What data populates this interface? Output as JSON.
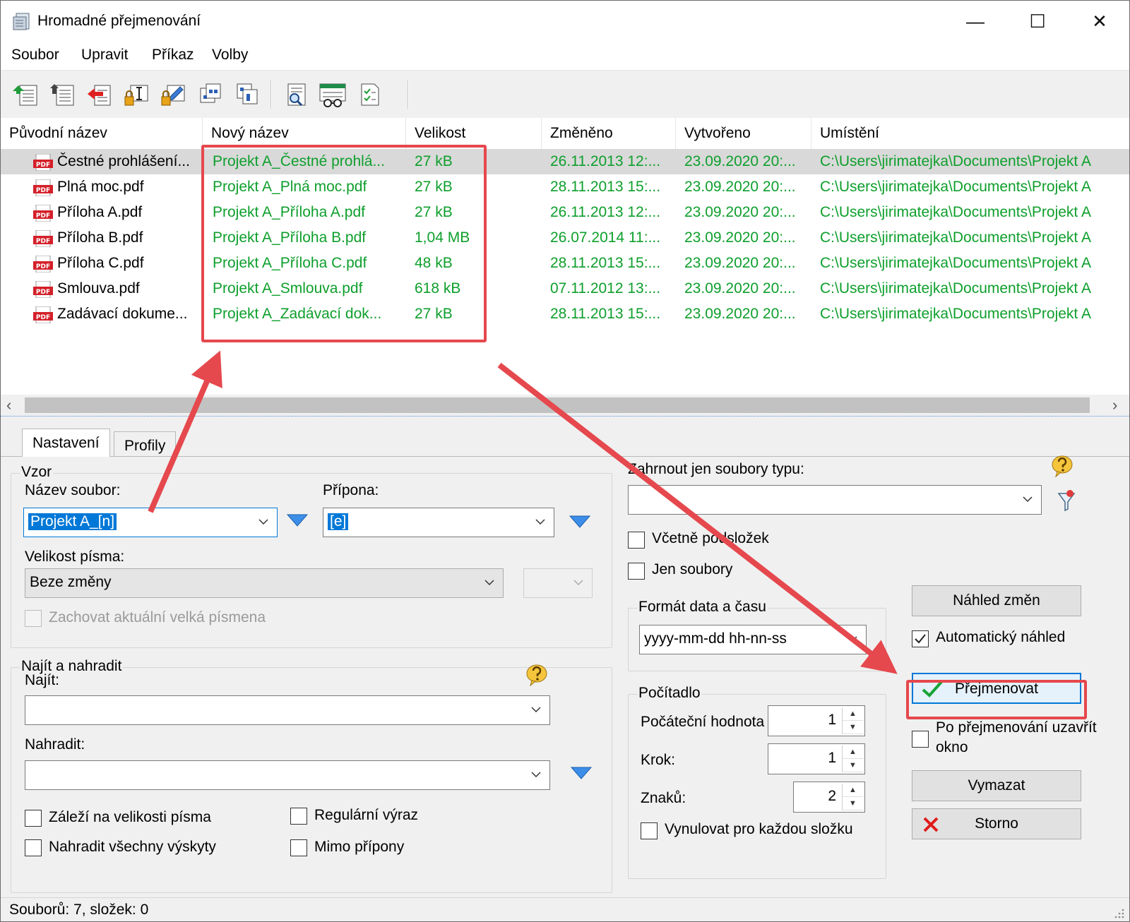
{
  "window": {
    "title": "Hromadné přejmenování",
    "minimize": "—",
    "maximize": "☐",
    "close": "✕"
  },
  "menu": [
    "Soubor",
    "Upravit",
    "Příkaz",
    "Volby"
  ],
  "toolbar": [
    "add-files-icon",
    "add-folder-icon",
    "remove-icon",
    "rename-lock-icon",
    "edit-lock-icon",
    "move-up-icon",
    "move-down-icon",
    "preview-icon",
    "settings-icon",
    "checklist-icon"
  ],
  "columns": [
    "Původní název",
    "Nový název",
    "Velikost",
    "Změněno",
    "Vytvořeno",
    "Umístění"
  ],
  "files": [
    {
      "orig": "Čestné prohlášení...",
      "new": "Projekt A_Čestné prohlá...",
      "size": "27 kB",
      "modified": "26.11.2013 12:...",
      "created": "23.09.2020 20:...",
      "path": "C:\\Users\\jirimatejka\\Documents\\Projekt A"
    },
    {
      "orig": "Plná moc.pdf",
      "new": "Projekt A_Plná moc.pdf",
      "size": "27 kB",
      "modified": "28.11.2013 15:...",
      "created": "23.09.2020 20:...",
      "path": "C:\\Users\\jirimatejka\\Documents\\Projekt A"
    },
    {
      "orig": "Příloha A.pdf",
      "new": "Projekt A_Příloha A.pdf",
      "size": "27 kB",
      "modified": "26.11.2013 12:...",
      "created": "23.09.2020 20:...",
      "path": "C:\\Users\\jirimatejka\\Documents\\Projekt A"
    },
    {
      "orig": "Příloha B.pdf",
      "new": "Projekt A_Příloha B.pdf",
      "size": "1,04 MB",
      "modified": "26.07.2014 11:...",
      "created": "23.09.2020 20:...",
      "path": "C:\\Users\\jirimatejka\\Documents\\Projekt A"
    },
    {
      "orig": "Příloha C.pdf",
      "new": "Projekt A_Příloha C.pdf",
      "size": "48 kB",
      "modified": "28.11.2013 15:...",
      "created": "23.09.2020 20:...",
      "path": "C:\\Users\\jirimatejka\\Documents\\Projekt A"
    },
    {
      "orig": "Smlouva.pdf",
      "new": "Projekt A_Smlouva.pdf",
      "size": "618 kB",
      "modified": "07.11.2012 13:...",
      "created": "23.09.2020 20:...",
      "path": "C:\\Users\\jirimatejka\\Documents\\Projekt A"
    },
    {
      "orig": "Zadávací dokume...",
      "new": "Projekt A_Zadávací dok...",
      "size": "27 kB",
      "modified": "28.11.2013 15:...",
      "created": "23.09.2020 20:...",
      "path": "C:\\Users\\jirimatejka\\Documents\\Projekt A"
    }
  ],
  "pdf_label": "PDF",
  "tabs": [
    "Nastavení",
    "Profily"
  ],
  "pattern": {
    "group": "Vzor",
    "filename_label": "Název soubor:",
    "filename_value": "Projekt A_[n]",
    "ext_label": "Přípona:",
    "ext_value": "[e]",
    "case_label": "Velikost písma:",
    "case_value": "Beze změny",
    "keep_upper": "Zachovat aktuální velká písmena"
  },
  "find": {
    "group": "Najít a nahradit",
    "find_label": "Najít:",
    "replace_label": "Nahradit:",
    "match_case": "Záleží na velikosti písma",
    "regex": "Regulární výraz",
    "replace_all": "Nahradit všechny výskyty",
    "skip_ext": "Mimo přípony"
  },
  "filter": {
    "label": "Zahrnout jen soubory typu:",
    "subfolders": "Včetně podsložek",
    "files_only": "Jen soubory"
  },
  "datetime": {
    "group": "Formát data a času",
    "value": "yyyy-mm-dd hh-nn-ss"
  },
  "counter": {
    "group": "Počítadlo",
    "start_label": "Počáteční hodnota",
    "start_value": "1",
    "step_label": "Krok:",
    "step_value": "1",
    "digits_label": "Znaků:",
    "digits_value": "2",
    "reset": "Vynulovat pro každou složku"
  },
  "actions": {
    "preview": "Náhled změn",
    "auto_preview": "Automatický náhled",
    "rename": "Přejmenovat",
    "close_after": "Po přejmenování uzavřít okno",
    "clear": "Vymazat",
    "cancel": "Storno"
  },
  "status": "Souborů: 7, složek: 0",
  "colors": {
    "green_text": "#0e9f2c",
    "annotation_red": "#e5484d",
    "selection": "#d9d9d9",
    "accent": "#0078d7"
  }
}
